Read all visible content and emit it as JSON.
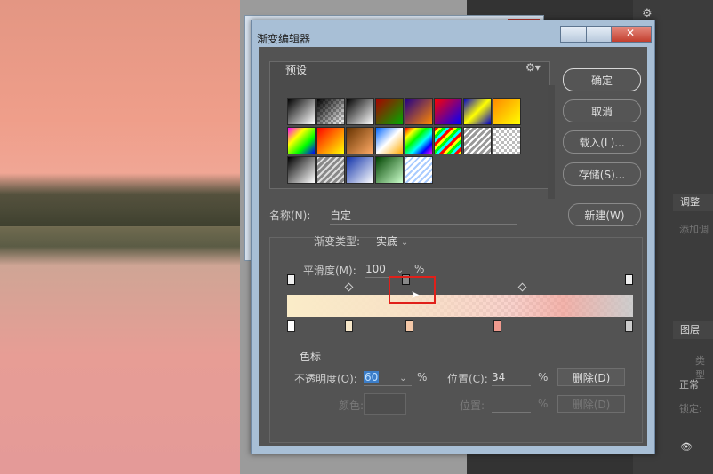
{
  "dialog": {
    "title": "渐变编辑器",
    "presets_label": "预设",
    "buttons": {
      "ok": "确定",
      "cancel": "取消",
      "load": "载入(L)...",
      "save": "存储(S)...",
      "new": "新建(W)"
    },
    "name_label": "名称(N):",
    "name_value": "自定",
    "gradient_type_label": "渐变类型:",
    "gradient_type_value": "实底",
    "smoothness_label": "平滑度(M):",
    "smoothness_value": "100",
    "smoothness_unit": "%",
    "stops": {
      "section_label": "色标",
      "opacity_label": "不透明度(O):",
      "opacity_value": "60",
      "opacity_unit": "%",
      "location_label": "位置(C):",
      "location_value": "34",
      "location_unit": "%",
      "delete_label": "删除(D)",
      "color_label": "颜色:",
      "color_location_label": "位置:",
      "color_location_unit": "%",
      "color_delete_label": "删除(D)"
    }
  },
  "right_panel": {
    "adjust_tab": "调整",
    "adjust_hint": "添加调",
    "layers_tab": "图层",
    "search_hint": "类型",
    "blend_mode": "正常",
    "lock_label": "锁定:"
  },
  "presets": [
    "linear-gradient(135deg,#000,#fff)",
    "linear-gradient(135deg,#000,rgba(0,0,0,0)),repeating-conic-gradient(#fff 0% 25%,#bbb 0% 50%) 0 0/6px 6px",
    "linear-gradient(135deg,#000,#fff)",
    "linear-gradient(135deg,#a00,#0a0)",
    "linear-gradient(135deg,#208,#f80)",
    "linear-gradient(135deg,#f00,#00f)",
    "linear-gradient(135deg,#00c,#ff0,#00c)",
    "linear-gradient(135deg,#f80,#ff0)",
    "linear-gradient(135deg,#f0f,#ff0,#0f0,#00f)",
    "linear-gradient(135deg,#f00,#ff0)",
    "linear-gradient(135deg,#630,#fa6)",
    "linear-gradient(135deg,#06f,#fff,#fa0)",
    "linear-gradient(135deg,#f00,#ff0,#0f0,#0ff,#00f,#f0f)",
    "repeating-linear-gradient(135deg,#f00 0 3px,#ff0 3px 6px,#0f0 6px 9px,#0ff 9px 12px)",
    "repeating-linear-gradient(135deg,#fff 0 2px,#999 2px 5px)",
    "repeating-conic-gradient(#fff 0% 25%,#bbb 0% 50%) 0 0/6px 6px",
    "linear-gradient(135deg,#000,#fff)",
    "repeating-linear-gradient(135deg,#ddd 0 2px,#888 2px 5px)",
    "linear-gradient(135deg,#13a,#fff)",
    "linear-gradient(135deg,#040,#cfc)",
    "repeating-linear-gradient(135deg,#acf 0 2px,#fff 2px 5px)"
  ],
  "opacity_stops": [
    {
      "pos": 0,
      "selected": false
    },
    {
      "pos": 0.34,
      "selected": true
    },
    {
      "pos": 1,
      "selected": false
    }
  ],
  "color_stops": [
    {
      "pos": 0,
      "color": "#ffffff"
    },
    {
      "pos": 0.17,
      "color": "#f6e7c9"
    },
    {
      "pos": 0.35,
      "color": "#f4c8a8"
    },
    {
      "pos": 0.61,
      "color": "#f09a8e"
    },
    {
      "pos": 1,
      "color": "#cccccc"
    }
  ],
  "midpoints": [
    0.17,
    0.67
  ]
}
